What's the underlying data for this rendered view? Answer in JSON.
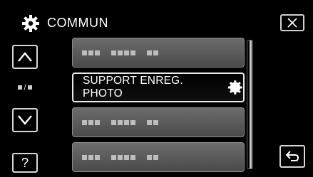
{
  "header": {
    "title": "COMMUN",
    "icon": "gear-icon"
  },
  "nav": {
    "up_icon": "chevron-up-icon",
    "down_icon": "chevron-down-icon",
    "close_icon": "close-icon",
    "back_icon": "return-arrow-icon",
    "help_label": "?",
    "page_indicator_icon": "page-indicator-icon"
  },
  "menu": {
    "items": [
      {
        "label": "",
        "placeholder": true,
        "icon": "redacted-text-icon"
      },
      {
        "label": "SUPPORT ENREG. PHOTO",
        "selected": true,
        "icon": "gear-icon"
      },
      {
        "label": "",
        "placeholder": true,
        "icon": "redacted-text-icon"
      },
      {
        "label": "",
        "placeholder": true,
        "icon": "redacted-text-icon"
      }
    ]
  },
  "colors": {
    "background": "#000000",
    "item_bg": "#5a5a5a",
    "border": "#d8d8d8",
    "text": "#ffffff"
  }
}
